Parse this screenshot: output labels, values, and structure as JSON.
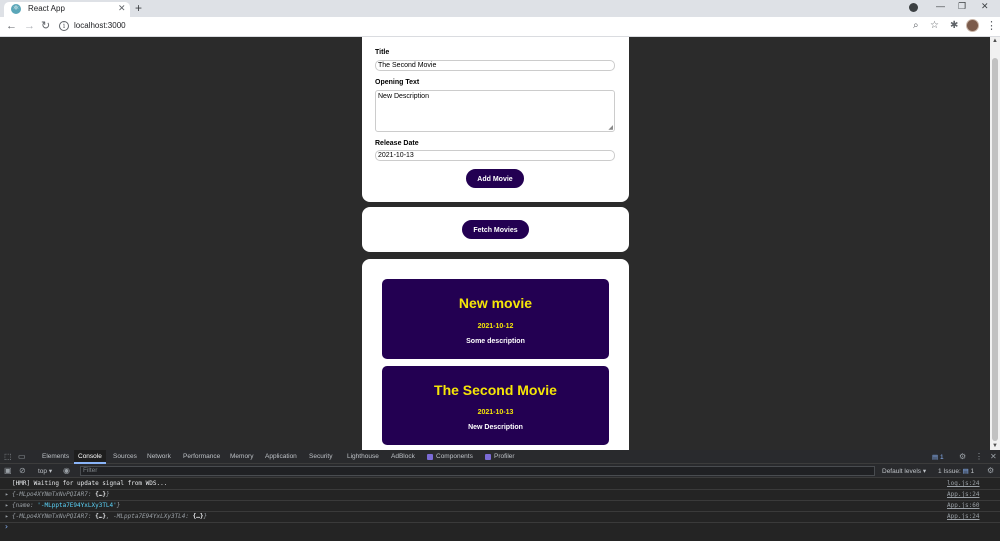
{
  "browser": {
    "tab_title": "React App",
    "tab_close": "✕",
    "new_tab": "+",
    "url": "localhost:3000",
    "win_min": "—",
    "win_restore": "❐",
    "win_close": "✕"
  },
  "form": {
    "title_label": "Title",
    "title_value": "The Second Movie",
    "opening_label": "Opening Text",
    "opening_value": "New Description",
    "release_label": "Release Date",
    "release_value": "2021-10-13",
    "add_button": "Add Movie"
  },
  "fetch_button": "Fetch Movies",
  "movies": [
    {
      "title": "New movie",
      "date": "2021-10-12",
      "description": "Some description"
    },
    {
      "title": "The Second Movie",
      "date": "2021-10-13",
      "description": "New Description"
    }
  ],
  "devtools": {
    "tabs": [
      "Elements",
      "Console",
      "Sources",
      "Network",
      "Performance",
      "Memory",
      "Application",
      "Security",
      "Lighthouse",
      "AdBlock",
      "Components",
      "Profiler"
    ],
    "issues_badge": "1",
    "context": "top ▾",
    "filter_placeholder": "Filter",
    "levels": "Default levels ▾",
    "issue_count": "1 Issue:",
    "issue_badge_count": "1",
    "console": [
      {
        "msg": "[HMR] Waiting for update signal from WDS...",
        "src": "log.js:24"
      },
      {
        "msg_pre": "{-MLpo4XYNmTxNvPQIAR7: ",
        "msg_obj": "{…}",
        "msg_post": "}",
        "src": "App.js:24"
      },
      {
        "msg_pre": "{name: ",
        "msg_str": "'-MLppta7E94YxLXy3TL4'",
        "msg_post": "}",
        "src": "App.js:60"
      },
      {
        "msg_pre": "{-MLpo4XYNmTxNvPQIAR7: ",
        "msg_obj": "{…}",
        "msg_mid": ", -MLppta7E94YxLXy3TL4: ",
        "msg_obj2": "{…}",
        "msg_post": "}",
        "src": "App.js:24"
      }
    ]
  },
  "colors": {
    "accent": "#230052",
    "movie_title": "#f5e507",
    "page_bg": "#2b2b2b"
  }
}
